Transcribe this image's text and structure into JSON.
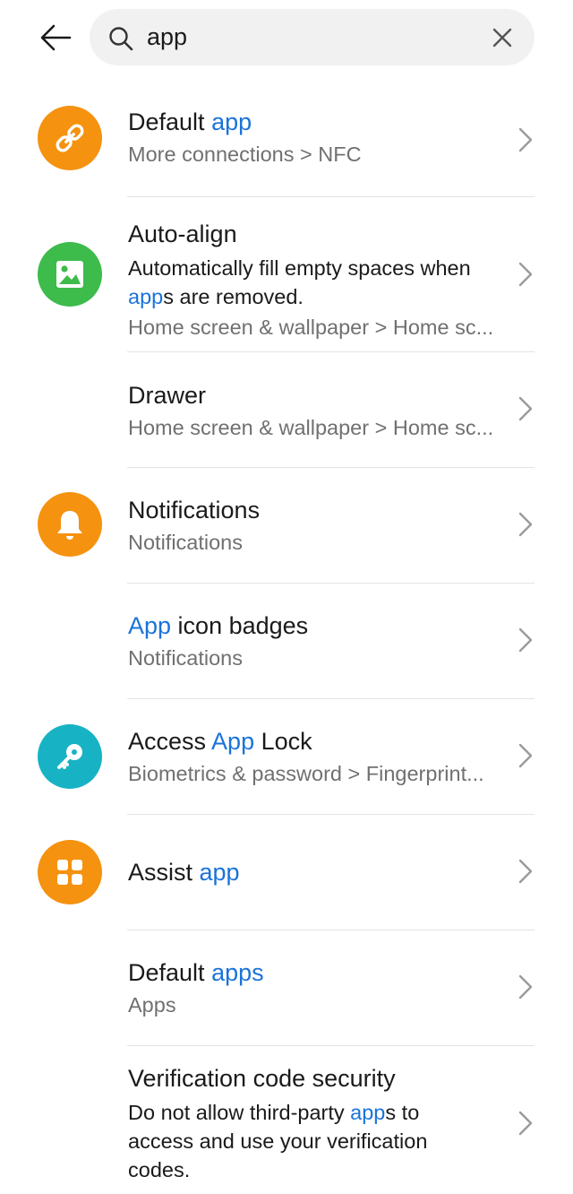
{
  "search": {
    "query": "app",
    "back_icon": "arrow-left-icon",
    "search_icon": "magnifier-icon",
    "clear_icon": "close-icon"
  },
  "results": [
    {
      "title_parts": [
        "Default ",
        "app"
      ],
      "title_highlight": [
        false,
        true
      ],
      "description": null,
      "path": "More connections > NFC",
      "icon": "link-icon",
      "icon_color": "#f5920f"
    },
    {
      "title_parts": [
        "Auto-align"
      ],
      "title_highlight": [
        false
      ],
      "description_parts": [
        "Automatically fill empty spaces when ",
        "app",
        "s are removed."
      ],
      "description_highlight": [
        false,
        true,
        false
      ],
      "path": "Home screen & wallpaper > Home sc...",
      "icon": "image-icon",
      "icon_color": "#3dbb4b"
    },
    {
      "title_parts": [
        "Drawer"
      ],
      "title_highlight": [
        false
      ],
      "path": "Home screen & wallpaper > Home sc...",
      "icon": null
    },
    {
      "title_parts": [
        "Notifications"
      ],
      "title_highlight": [
        false
      ],
      "path": "Notifications",
      "icon": "bell-icon",
      "icon_color": "#f5920f"
    },
    {
      "title_parts": [
        "App",
        " icon badges"
      ],
      "title_highlight": [
        true,
        false
      ],
      "path": "Notifications",
      "icon": null
    },
    {
      "title_parts": [
        "Access ",
        "App",
        " Lock"
      ],
      "title_highlight": [
        false,
        true,
        false
      ],
      "path": "Biometrics & password > Fingerprint...",
      "icon": "key-icon",
      "icon_color": "#17b3c4"
    },
    {
      "title_parts": [
        "Assist ",
        "app"
      ],
      "title_highlight": [
        false,
        true
      ],
      "path": null,
      "icon": "apps-grid-icon",
      "icon_color": "#f5920f"
    },
    {
      "title_parts": [
        "Default ",
        "apps"
      ],
      "title_highlight": [
        false,
        true
      ],
      "path": "Apps",
      "icon": null
    },
    {
      "title_parts": [
        "Verification code security"
      ],
      "title_highlight": [
        false
      ],
      "description_parts": [
        "Do not allow third-party ",
        "app",
        "s to access and use your verification codes."
      ],
      "description_highlight": [
        false,
        true,
        false
      ],
      "path": null,
      "icon": null
    }
  ],
  "colors": {
    "highlight": "#1a73d9",
    "orange": "#f5920f",
    "green": "#3dbb4b",
    "teal": "#17b3c4",
    "chevron": "#9a9a9a"
  }
}
